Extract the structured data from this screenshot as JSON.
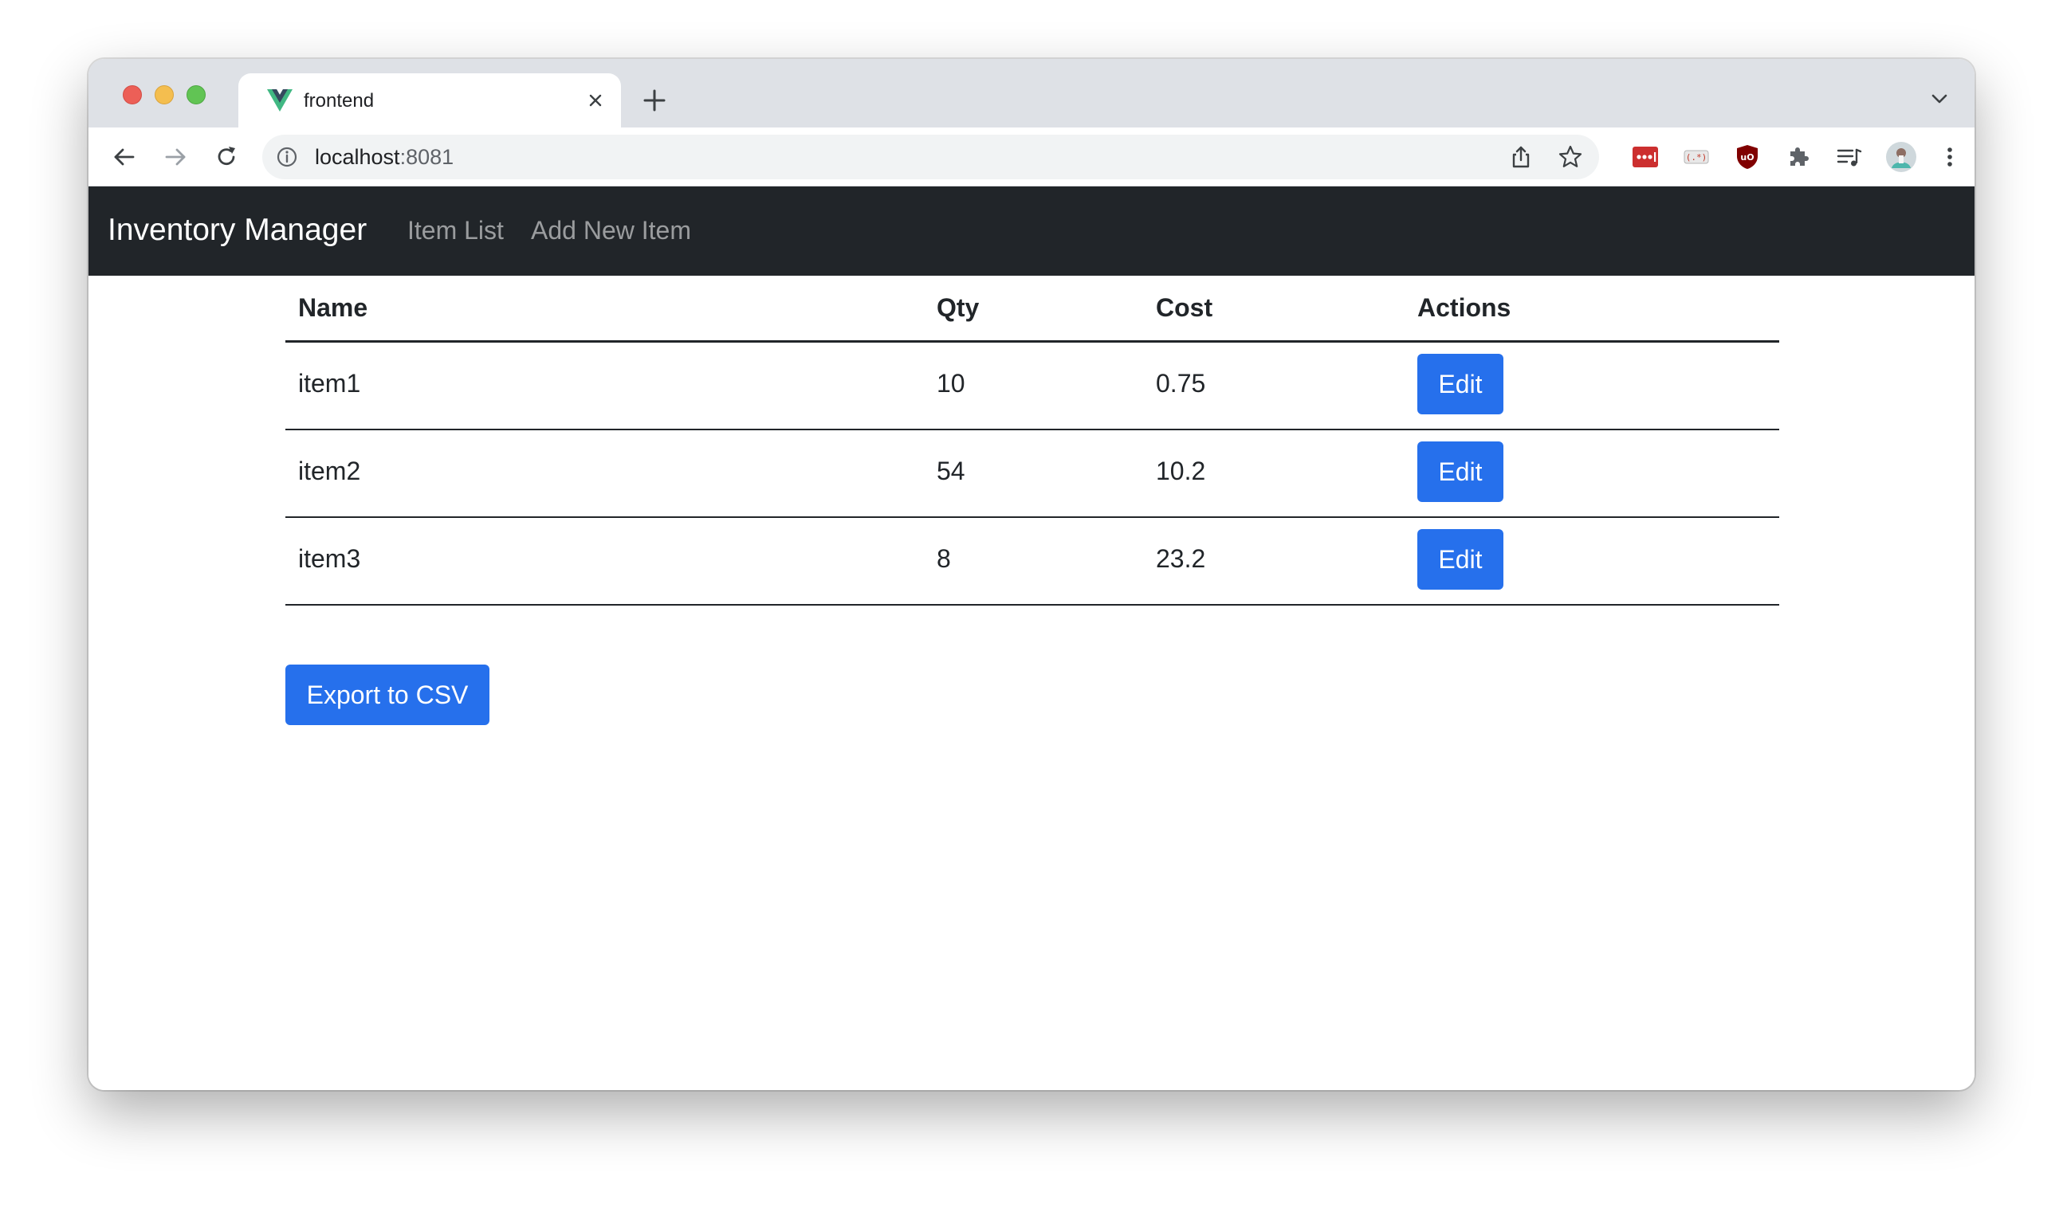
{
  "browser": {
    "tab_title": "frontend",
    "url_host": "localhost",
    "url_port": ":8081",
    "colors": {
      "tabstrip": "#dee1e6",
      "toolbar": "#ffffff",
      "omnibox": "#f1f3f4"
    }
  },
  "navbar": {
    "brand": "Inventory Manager",
    "links": [
      {
        "label": "Item List"
      },
      {
        "label": "Add New Item"
      }
    ],
    "background": "#212529"
  },
  "table": {
    "headers": {
      "name": "Name",
      "qty": "Qty",
      "cost": "Cost",
      "actions": "Actions"
    },
    "rows": [
      {
        "name": "item1",
        "qty": "10",
        "cost": "0.75",
        "action_label": "Edit"
      },
      {
        "name": "item2",
        "qty": "54",
        "cost": "10.2",
        "action_label": "Edit"
      },
      {
        "name": "item3",
        "qty": "8",
        "cost": "23.2",
        "action_label": "Edit"
      }
    ]
  },
  "export_button": {
    "label": "Export to CSV"
  },
  "accent_color": "#2670ec",
  "icons": [
    "vue-favicon-icon",
    "close-icon",
    "plus-icon",
    "chevron-down-icon",
    "back-icon",
    "forward-icon",
    "reload-icon",
    "info-icon",
    "share-icon",
    "star-icon",
    "lastpass-extension-icon",
    "regex-extension-icon",
    "ublock-extension-icon",
    "puzzle-icon",
    "media-queue-icon",
    "profile-avatar-icon",
    "kebab-menu-icon"
  ]
}
